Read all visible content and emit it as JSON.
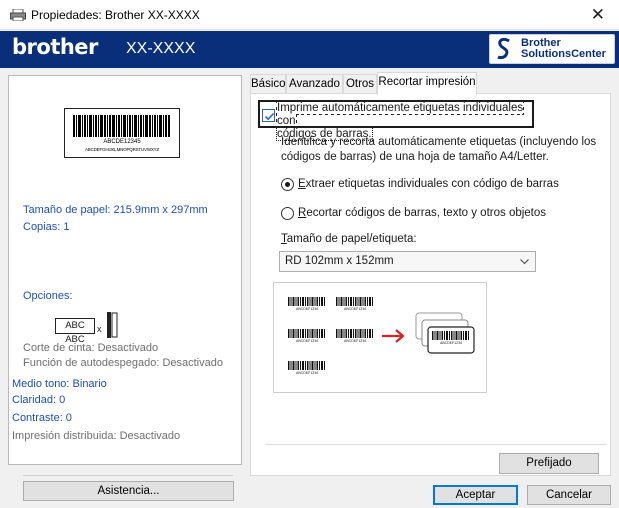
{
  "window": {
    "title": "Propiedades: Brother  XX-XXXX",
    "close_glyph": "✕"
  },
  "brand": {
    "logo": "brother",
    "model": "XX-XXXX",
    "solutions_line1": "Brother",
    "solutions_line2": "SolutionsCenter",
    "header_color": "#0a2f7a"
  },
  "left_panel": {
    "preview_code": "ABCDE12345",
    "preview_small_code": "ABCDEFGHIJKLMNOPQRSTUVWXYZ",
    "paper_size": "Tamaño de papel: 215.9mm x 297mm",
    "copies": "Copias: 1",
    "options_heading": "Opciones:",
    "tape_icon_text": "ABC ABC",
    "tape_icon_x": "x",
    "cut_tape": "Corte de cinta: Desactivado",
    "auto_peel": "Función de autodespegado: Desactivado",
    "halftone": "Medio tono: Binario",
    "brightness": "Claridad:  0",
    "contrast": "Contraste:  0",
    "distributed": "Impresión distribuida: Desactivado",
    "support_button": "Asistencia..."
  },
  "tabs": [
    {
      "label": "Básico",
      "active": false
    },
    {
      "label": "Avanzado",
      "active": false
    },
    {
      "label": "Otros",
      "active": false
    },
    {
      "label": "Recortar impresión",
      "active": true
    }
  ],
  "crop_tab": {
    "auto_print_checkbox": {
      "checked": true,
      "label_line1": "Imprime automáticamente etiquetas individuales con",
      "label_line2": "códigos de barras."
    },
    "description_line1": "Identifica y recorta automáticamente etiquetas (incluyendo los",
    "description_line2": "códigos de barras) de una hoja de tamaño A4/Letter.",
    "radio_extract": {
      "label_prefix": "",
      "label_mnemonic": "E",
      "label_rest": "xtraer etiquetas individuales con código de barras",
      "selected": true
    },
    "radio_crop": {
      "label_prefix": "",
      "label_mnemonic": "R",
      "label_rest": "ecortar códigos de barras, texto y otros objetos",
      "selected": false
    },
    "size_label_prefix": "",
    "size_label_mnemonic": "T",
    "size_label_rest": "amaño de papel/etiqueta:",
    "size_value": "RD 102mm x 152mm",
    "illustration_code": "ABCDEF1234",
    "default_button": "Prefijado"
  },
  "footer": {
    "ok_button": "Aceptar",
    "cancel_button": "Cancelar"
  },
  "colors": {
    "accent_blue": "#1f4fb4",
    "arrow_red": "#e02020",
    "focus_blue": "#0078d7"
  }
}
